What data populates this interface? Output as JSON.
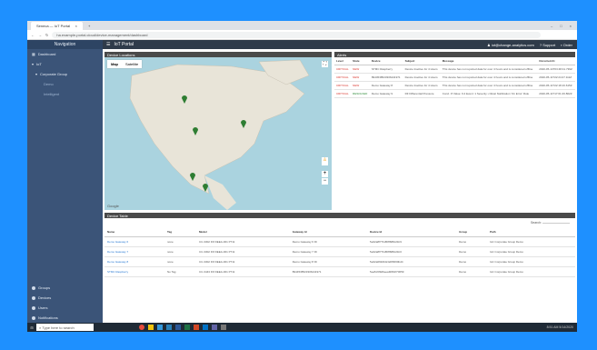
{
  "browser": {
    "tab_title": "Seneca — IoT Portal",
    "tab_close": "×",
    "new_tab": "+",
    "url": "ha.example-portal.cloud/device-management/dashboard",
    "window_controls": [
      "–",
      "□",
      "×"
    ]
  },
  "header": {
    "brand": "IoT Portal",
    "user": "iot@change-analytics.com",
    "support": "Support",
    "order": "Order"
  },
  "sidebar": {
    "title": "Navigation",
    "items": [
      {
        "label": "Dashboard"
      },
      {
        "label": "IoT"
      },
      {
        "label": "Corporate Group"
      },
      {
        "label": "Demo"
      },
      {
        "label": "Intelligent"
      }
    ],
    "bottom": [
      {
        "label": "Groups"
      },
      {
        "label": "Devices"
      },
      {
        "label": "Users"
      },
      {
        "label": "Notifications"
      }
    ]
  },
  "map": {
    "section": "Device Locations",
    "tab_map": "Map",
    "tab_satellite": "Satellite",
    "google": "Google",
    "zoom_in": "+",
    "zoom_out": "−"
  },
  "alerts": {
    "section": "Alerts",
    "columns": [
      "Level",
      "State",
      "Device",
      "Subject",
      "Message",
      "Occurred At"
    ],
    "rows": [
      {
        "level": "CRITICAL",
        "state": "NEW",
        "device": "STMC Raspberry",
        "subject": "Device Inactive for 4 Hours",
        "message": "This device has not reported data for over 4 hours and is considered offline",
        "time": "2020-05-14T03:48:41.739Z"
      },
      {
        "level": "CRITICAL",
        "state": "NEW",
        "device": "8944538523306241971",
        "subject": "Device Inactive for 4 Hours",
        "message": "This device has not reported data for over 4 hours and is considered offline",
        "time": "2020-05-11T22:24:27.111Z"
      },
      {
        "level": "CRITICAL",
        "state": "NEW",
        "device": "Demo Gateway 8",
        "subject": "Device Inactive for 4 Hours",
        "message": "This device has not reported data for over 4 hours and is considered offline",
        "time": "2020-05-11T22:18:16.615Z"
      },
      {
        "level": "CRITICAL",
        "state": "RESOLVED",
        "device": "Demo Gateway 9",
        "subject": "RF Differential Pressure",
        "message": "Cond.: 8 Value: 9.4 Event: 1 Severity: critical Notification 'On Error' Rule",
        "time": "2020-05-11T17:01:26.802Z"
      }
    ]
  },
  "devices": {
    "section": "Device Table",
    "search_label": "Search:",
    "columns": [
      "Name",
      "Tag",
      "Model",
      "Gateway Id",
      "Device Id",
      "Group",
      "Path"
    ],
    "rows": [
      {
        "name": "Demo Gateway 6",
        "tag": "none",
        "model": "CC-3302 FR DEEA-001 P711",
        "gateway": "Demo Gateway 6 ID",
        "device": "5e02a8f77bd58f688c21b9",
        "group": "Demo",
        "path": "IoC Corporate Group Demo"
      },
      {
        "name": "Demo Gateway 7",
        "tag": "none",
        "model": "CC-3302 FR DEEA-001 P711",
        "gateway": "Demo Gateway 7 ID",
        "device": "5e02a8f77bd58f688c21b0",
        "group": "Demo",
        "path": "IoC Corporate Group Demo"
      },
      {
        "name": "Demo Gateway 8",
        "tag": "none",
        "model": "CC-3302 FR DEEA-001 P711",
        "gateway": "Demo Gateway 8 ID",
        "device": "5e02a6f4fdb0c4d8f4f00bd4",
        "group": "Demo",
        "path": "IoC Corporate Group Demo"
      },
      {
        "name": "STMC Raspberry",
        "tag": "No Tag",
        "model": "CC-3443 FR DEEA-001 P711",
        "gateway": "8944538523306241971",
        "device": "5ea5c6f9d6eeaf2891f70659",
        "group": "Demo",
        "path": "IoC Corporate Group Demo"
      }
    ]
  },
  "taskbar": {
    "search": "Type here to search",
    "time": "8:51 AM",
    "date": "5/14/2020"
  }
}
